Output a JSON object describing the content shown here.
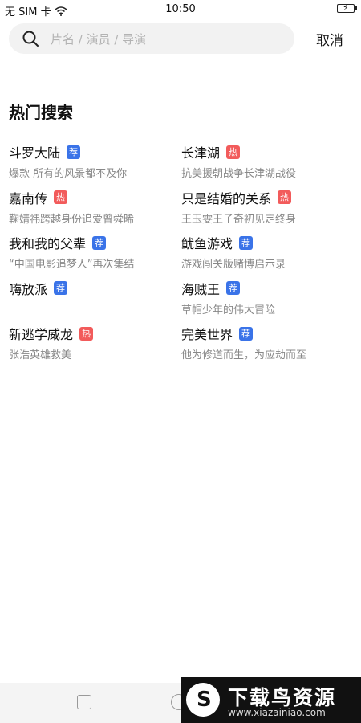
{
  "status_bar": {
    "carrier": "无 SIM 卡",
    "time": "10:50"
  },
  "search": {
    "placeholder": "片名 / 演员 / 导演",
    "cancel_label": "取消"
  },
  "section_title": "热门搜索",
  "badges": {
    "rec": "荐",
    "hot": "热"
  },
  "hot_items": [
    {
      "name": "斗罗大陆",
      "badge": "荐",
      "desc": "爆款 所有的风景都不及你"
    },
    {
      "name": "长津湖",
      "badge": "热",
      "desc": "抗美援朝战争长津湖战役"
    },
    {
      "name": "嘉南传",
      "badge": "热",
      "desc": "鞠婧祎跨越身份追爱曾舜晞"
    },
    {
      "name": "只是结婚的关系",
      "badge": "热",
      "desc": "王玉雯王子奇初见定终身"
    },
    {
      "name": "我和我的父辈",
      "badge": "荐",
      "desc": "“中国电影追梦人”再次集结"
    },
    {
      "name": "鱿鱼游戏",
      "badge": "荐",
      "desc": "游戏闯关版赌博启示录"
    },
    {
      "name": "嗨放派",
      "badge": "荐",
      "desc": ""
    },
    {
      "name": "海贼王",
      "badge": "荐",
      "desc": "草帽少年的伟大冒险"
    },
    {
      "name": "新逃学威龙",
      "badge": "热",
      "desc": "张浩英雄救美"
    },
    {
      "name": "完美世界",
      "badge": "荐",
      "desc": "他为修道而生，为应劫而至"
    }
  ],
  "watermark": {
    "title": "下载鸟资源",
    "url": "www.xiazainiao.com"
  },
  "colors": {
    "rec_badge": "#3a73e8",
    "hot_badge": "#f25b5b"
  }
}
